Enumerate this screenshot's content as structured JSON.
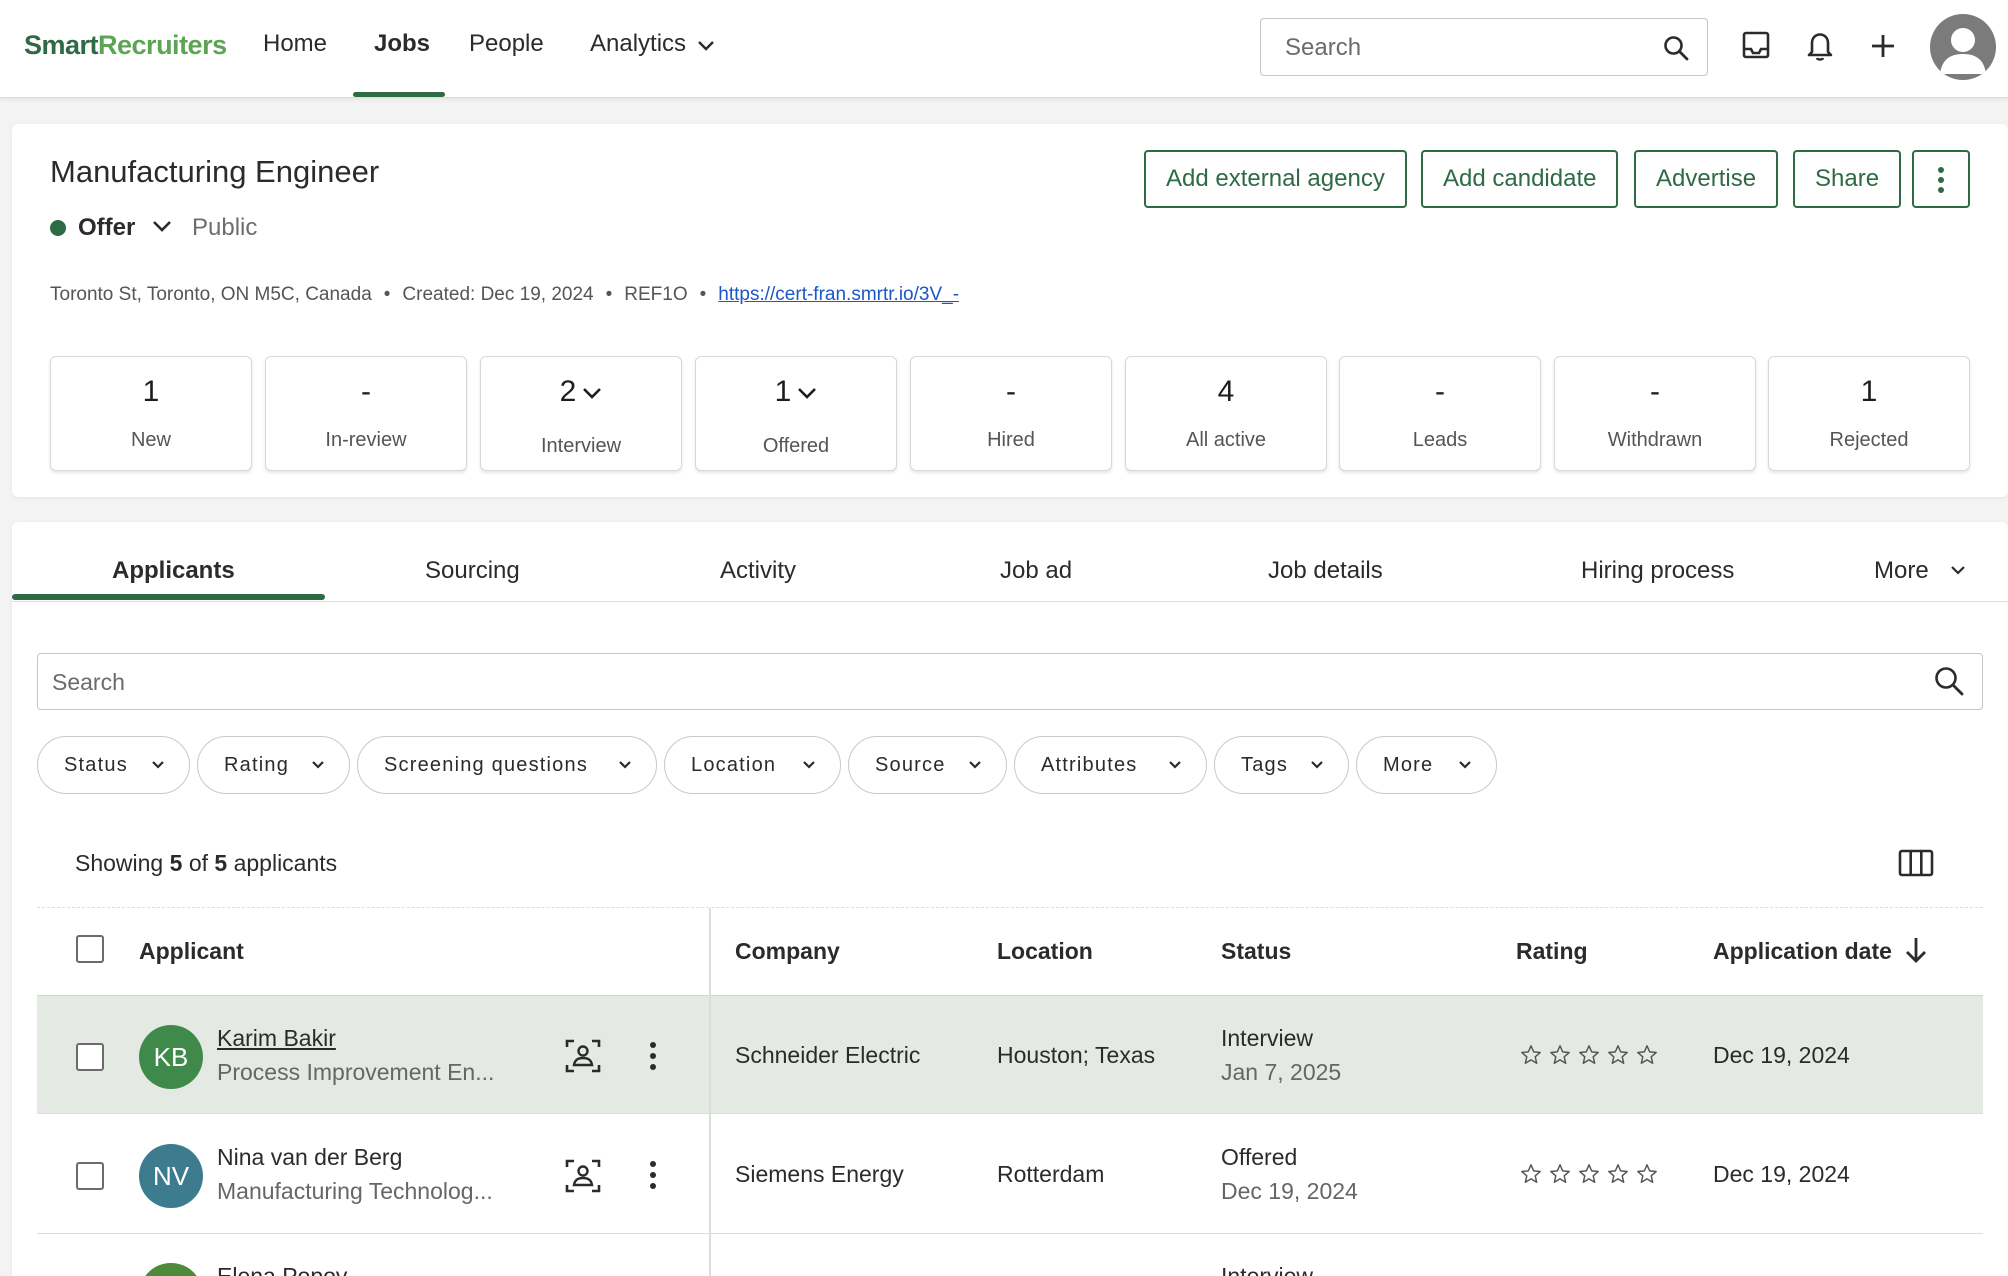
{
  "nav": {
    "logo_part1": "Smart",
    "logo_part2": "Recruiters",
    "links": [
      "Home",
      "Jobs",
      "People",
      "Analytics"
    ],
    "search_placeholder": "Search"
  },
  "job": {
    "title": "Manufacturing Engineer",
    "status": "Offer",
    "visibility": "Public",
    "address": "Toronto St, Toronto, ON M5C, Canada",
    "created": "Created: Dec 19, 2024",
    "ref": "REF1O",
    "url": "https://cert-fran.smrtr.io/3V_-",
    "status_color": "#2e6b45"
  },
  "actions": {
    "agency": "Add external agency",
    "candidate": "Add candidate",
    "advertise": "Advertise",
    "share": "Share"
  },
  "stages": [
    {
      "count": "1",
      "label": "New"
    },
    {
      "count": "-",
      "label": "In-review"
    },
    {
      "count": "2",
      "label": "Interview"
    },
    {
      "count": "1",
      "label": "Offered"
    },
    {
      "count": "-",
      "label": "Hired"
    },
    {
      "count": "4",
      "label": "All active"
    },
    {
      "count": "-",
      "label": "Leads"
    },
    {
      "count": "-",
      "label": "Withdrawn"
    },
    {
      "count": "1",
      "label": "Rejected"
    }
  ],
  "tabs": [
    "Applicants",
    "Sourcing",
    "Activity",
    "Job ad",
    "Job details",
    "Hiring process",
    "More"
  ],
  "applicants": {
    "search_placeholder": "Search",
    "filters": [
      "Status",
      "Rating",
      "Screening questions",
      "Location",
      "Source",
      "Attributes",
      "Tags",
      "More"
    ],
    "showing_prefix": "Showing",
    "showing_count": "5",
    "showing_of": "of",
    "showing_total": "5",
    "showing_suffix": "applicants",
    "columns": [
      "Applicant",
      "Company",
      "Location",
      "Status",
      "Rating",
      "Application date"
    ],
    "rows": [
      {
        "initials": "KB",
        "name": "Karim Bakir",
        "role": "Process Improvement En...",
        "company": "Schneider Electric",
        "location": "Houston; Texas",
        "status": "Interview",
        "status_date": "Jan 7, 2025",
        "rating": 0,
        "date": "Dec 19, 2024",
        "avatar_color": "#3f8a4a"
      },
      {
        "initials": "NV",
        "name": "Nina van der Berg",
        "role": "Manufacturing Technolog...",
        "company": "Siemens Energy",
        "location": "Rotterdam",
        "status": "Offered",
        "status_date": "Dec 19, 2024",
        "rating": 0,
        "date": "Dec 19, 2024",
        "avatar_color": "#3d7b8e"
      },
      {
        "initials": "",
        "name": "Elena Popov",
        "role": "",
        "company": "",
        "location": "",
        "status": "Interview",
        "status_date": "",
        "rating": 0,
        "date": "",
        "avatar_color": "#4e8a3a"
      }
    ]
  },
  "colors": {
    "brand": "#2e6b45",
    "brand_light": "#5da454",
    "highlight_row": "#e4e9e4",
    "link": "#1a57c7"
  }
}
